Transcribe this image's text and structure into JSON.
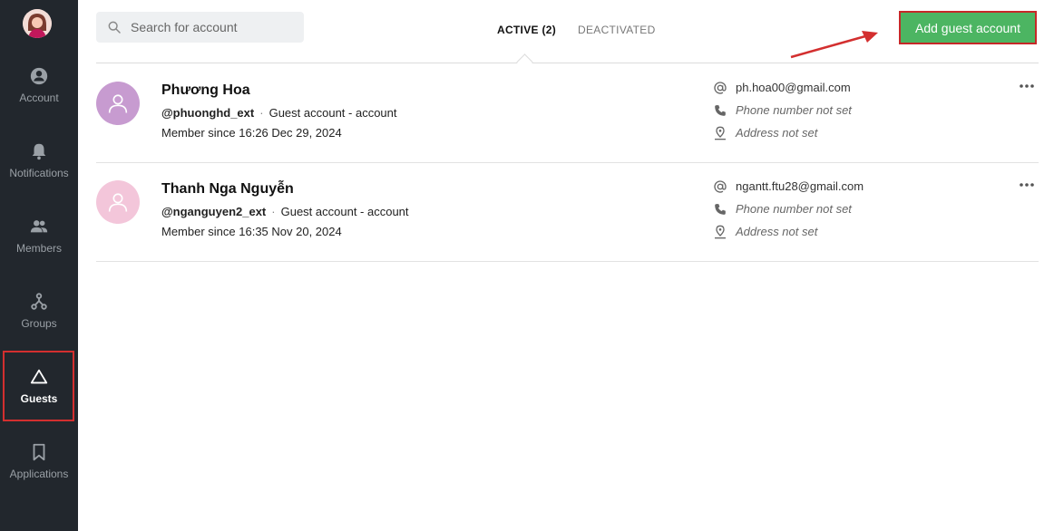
{
  "sidebar": {
    "items": [
      {
        "label": "Account",
        "icon": "account-icon"
      },
      {
        "label": "Notifications",
        "icon": "bell-icon"
      },
      {
        "label": "Members",
        "icon": "members-icon"
      },
      {
        "label": "Groups",
        "icon": "groups-icon"
      },
      {
        "label": "Guests",
        "icon": "guests-icon"
      },
      {
        "label": "Applications",
        "icon": "bookmark-icon"
      }
    ],
    "active": "Guests"
  },
  "search": {
    "placeholder": "Search for account"
  },
  "tabs": [
    {
      "label": "ACTIVE (2)"
    },
    {
      "label": "DEACTIVATED"
    }
  ],
  "add_button": {
    "label": "Add guest account"
  },
  "accounts": [
    {
      "name": "Phương Hoa",
      "handle": "@phuonghd_ext",
      "type": "Guest account - account",
      "since": "Member since 16:26 Dec 29, 2024",
      "email": "ph.hoa00@gmail.com",
      "phone": "Phone number not set",
      "address": "Address not set",
      "avatar_color": "#c79bd0"
    },
    {
      "name": "Thanh Nga Nguyễn",
      "handle": "@nganguyen2_ext",
      "type": "Guest account - account",
      "since": "Member since 16:35 Nov 20, 2024",
      "email": "ngantt.ftu28@gmail.com",
      "phone": "Phone number not set",
      "address": "Address not set",
      "avatar_color": "#f3c6da"
    }
  ],
  "colors": {
    "sidebar_bg": "#22272d",
    "accent_green": "#4cb562",
    "highlight_red": "#d32f2f"
  }
}
